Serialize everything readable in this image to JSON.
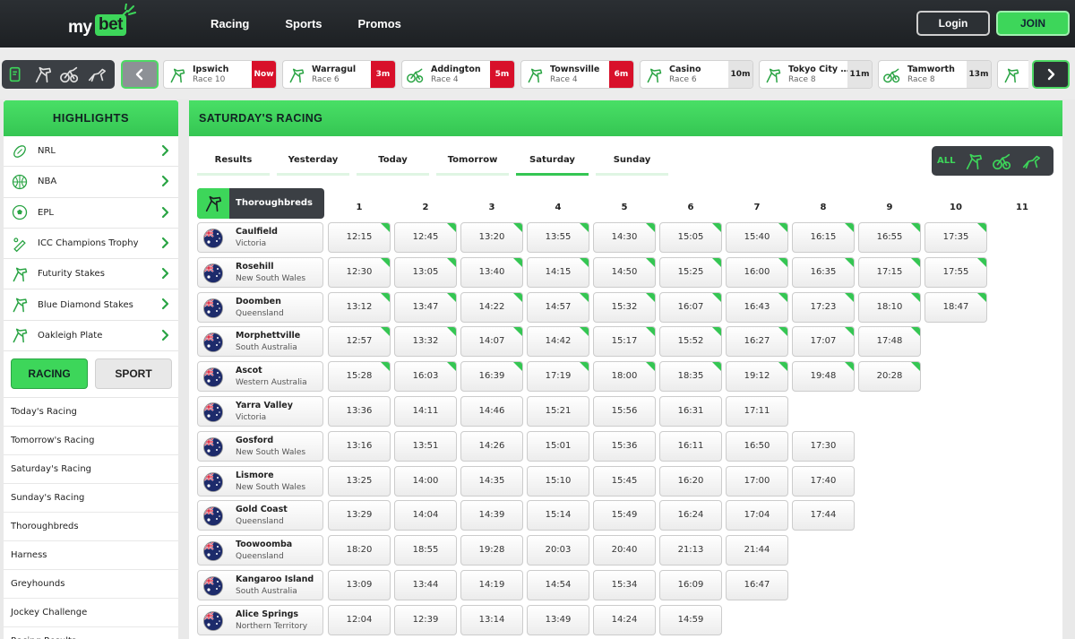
{
  "brand": {
    "my": "my",
    "bet": "bet"
  },
  "nav": [
    "Racing",
    "Sports",
    "Promos"
  ],
  "auth": {
    "login": "Login",
    "join": "JOIN"
  },
  "next_to_go": [
    {
      "venue": "Ipswich",
      "race": "Race 10",
      "time": "Now",
      "type": "thoroughbred",
      "status": "red"
    },
    {
      "venue": "Warragul",
      "race": "Race 6",
      "time": "3m",
      "type": "thoroughbred",
      "status": "red"
    },
    {
      "venue": "Addington",
      "race": "Race 4",
      "time": "5m",
      "type": "harness",
      "status": "red"
    },
    {
      "venue": "Townsville",
      "race": "Race 4",
      "time": "6m",
      "type": "thoroughbred",
      "status": "red"
    },
    {
      "venue": "Casino",
      "race": "Race 6",
      "time": "10m",
      "type": "thoroughbred",
      "status": "grey"
    },
    {
      "venue": "Tokyo City ...",
      "race": "Race 8",
      "time": "11m",
      "type": "thoroughbred",
      "status": "grey"
    },
    {
      "venue": "Tamworth",
      "race": "Race 8",
      "time": "13m",
      "type": "harness",
      "status": "grey"
    },
    {
      "venue": "",
      "race": "",
      "time": "",
      "type": "thoroughbred",
      "status": "none"
    }
  ],
  "highlights": {
    "title": "HIGHLIGHTS",
    "items": [
      {
        "label": "NRL",
        "icon": "rugby-ball-icon"
      },
      {
        "label": "NBA",
        "icon": "basketball-icon"
      },
      {
        "label": "EPL",
        "icon": "soccer-ball-icon"
      },
      {
        "label": "ICC Champions Trophy",
        "icon": "cricket-icon"
      },
      {
        "label": "Futurity Stakes",
        "icon": "horse-icon"
      },
      {
        "label": "Blue Diamond Stakes",
        "icon": "horse-icon"
      },
      {
        "label": "Oakleigh Plate",
        "icon": "horse-icon"
      }
    ]
  },
  "segment": {
    "racing": "RACING",
    "sport": "SPORT"
  },
  "side_links": [
    "Today's Racing",
    "Tomorrow's Racing",
    "Saturday's Racing",
    "Sunday's Racing",
    "Thoroughbreds",
    "Harness",
    "Greyhounds",
    "Jockey Challenge",
    "Racing Results"
  ],
  "main": {
    "title": "SATURDAY'S RACING",
    "tabs": [
      "Results",
      "Yesterday",
      "Today",
      "Tomorrow",
      "Saturday",
      "Sunday"
    ],
    "active_tab": "Saturday",
    "filter_all": "ALL",
    "section": "Thoroughbreds",
    "race_numbers": [
      "1",
      "2",
      "3",
      "4",
      "5",
      "6",
      "7",
      "8",
      "9",
      "10",
      "11"
    ],
    "meetings": [
      {
        "venue": "Caulfield",
        "state": "Victoria",
        "times": [
          "12:15",
          "12:45",
          "13:20",
          "13:55",
          "14:30",
          "15:05",
          "15:40",
          "16:15",
          "16:55",
          "17:35"
        ]
      },
      {
        "venue": "Rosehill",
        "state": "New South Wales",
        "times": [
          "12:30",
          "13:05",
          "13:40",
          "14:15",
          "14:50",
          "15:25",
          "16:00",
          "16:35",
          "17:15",
          "17:55"
        ]
      },
      {
        "venue": "Doomben",
        "state": "Queensland",
        "times": [
          "13:12",
          "13:47",
          "14:22",
          "14:57",
          "15:32",
          "16:07",
          "16:43",
          "17:23",
          "18:10",
          "18:47"
        ]
      },
      {
        "venue": "Morphettville",
        "state": "South Australia",
        "times": [
          "12:57",
          "13:32",
          "14:07",
          "14:42",
          "15:17",
          "15:52",
          "16:27",
          "17:07",
          "17:48"
        ]
      },
      {
        "venue": "Ascot",
        "state": "Western Australia",
        "times": [
          "15:28",
          "16:03",
          "16:39",
          "17:19",
          "18:00",
          "18:35",
          "19:12",
          "19:48",
          "20:28"
        ]
      },
      {
        "venue": "Yarra Valley",
        "state": "Victoria",
        "times": [
          "13:36",
          "14:11",
          "14:46",
          "15:21",
          "15:56",
          "16:31",
          "17:11"
        ]
      },
      {
        "venue": "Gosford",
        "state": "New South Wales",
        "times": [
          "13:16",
          "13:51",
          "14:26",
          "15:01",
          "15:36",
          "16:11",
          "16:50",
          "17:30"
        ]
      },
      {
        "venue": "Lismore",
        "state": "New South Wales",
        "times": [
          "13:25",
          "14:00",
          "14:35",
          "15:10",
          "15:45",
          "16:20",
          "17:00",
          "17:40"
        ]
      },
      {
        "venue": "Gold Coast",
        "state": "Queensland",
        "times": [
          "13:29",
          "14:04",
          "14:39",
          "15:14",
          "15:49",
          "16:24",
          "17:04",
          "17:44"
        ]
      },
      {
        "venue": "Toowoomba",
        "state": "Queensland",
        "times": [
          "18:20",
          "18:55",
          "19:28",
          "20:03",
          "20:40",
          "21:13",
          "21:44"
        ]
      },
      {
        "venue": "Kangaroo Island",
        "state": "South Australia",
        "times": [
          "13:09",
          "13:44",
          "14:19",
          "14:54",
          "15:34",
          "16:09",
          "16:47"
        ]
      },
      {
        "venue": "Alice Springs",
        "state": "Northern Territory",
        "times": [
          "12:04",
          "12:39",
          "13:14",
          "13:49",
          "14:24",
          "14:59"
        ]
      }
    ],
    "featured_rows": 5
  },
  "colors": {
    "accent": "#3dd65a",
    "dark": "#3b3f44",
    "countdown_red": "#d8102a"
  }
}
